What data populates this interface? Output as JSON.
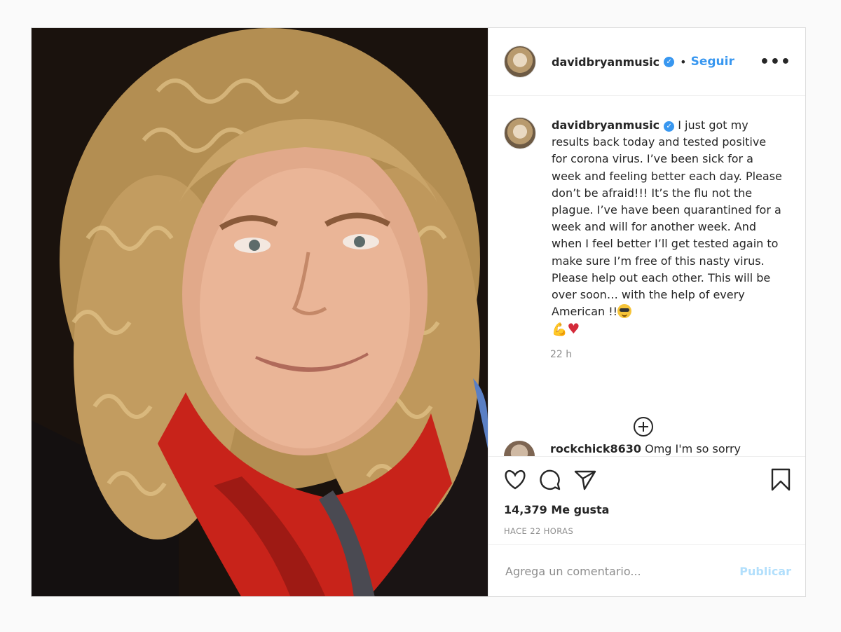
{
  "post": {
    "username": "davidbryanmusic",
    "verified_icon": "verified-badge-icon",
    "follow_label": "Seguir",
    "more_label": "•••",
    "caption_username": "davidbryanmusic",
    "caption_text": " I just got my results back today and tested positive for corona virus. I’ve been sick for a week and feeling better each day. Please don’t be afraid!!! It’s the flu not the plague. I’ve have been quarantined for a week and will for another week. And when I feel better I’ll get tested again to make sure I’m free of this nasty virus. Please help out each other. This will be over soon… with the help of every American !!",
    "caption_time": "22 h",
    "comment": {
      "username": "rockchick8630",
      "text": " Omg I'm so sorry"
    },
    "likes": "14,379 Me gusta",
    "posted_ago": "HACE 22 HORAS",
    "comment_placeholder": "Agrega un comentario...",
    "publish_label": "Publicar"
  },
  "colors": {
    "accent": "#3897f0",
    "publish_disabled": "#b2dffc",
    "scarf": "#c8231a",
    "hair": "#c9a468"
  }
}
